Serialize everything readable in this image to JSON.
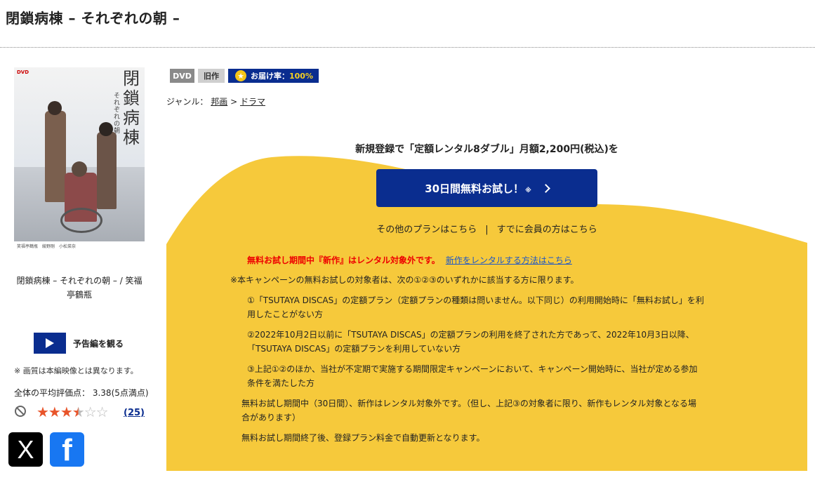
{
  "page": {
    "title": "閉鎖病棟 – それぞれの朝 –"
  },
  "jacket": {
    "dvd_mark": "DVD",
    "vertical_title": "閉鎖病棟",
    "vertical_subtitle": "それぞれの朝",
    "cast_line": "笑福亭鶴瓶　綾野剛　小松菜奈",
    "caption": "閉鎖病棟 – それぞれの朝 – / 笑福亭鶴瓶"
  },
  "trailer": {
    "label": "予告編を観る",
    "icon": "play-icon"
  },
  "quality_note": "※ 画質は本編映像とは異なります。",
  "rating": {
    "label": "全体の平均評価点：",
    "value": "3.38(5点満点)",
    "stars_filled": "★★★",
    "stars_half": "★",
    "stars_empty": "☆☆",
    "score": 3.38,
    "review_count": "(25)",
    "not_interested_icon": "prohibited-icon"
  },
  "share": {
    "x_glyph": "X",
    "facebook_glyph": "f"
  },
  "badges": {
    "format": "DVD",
    "age": "旧作",
    "delivery_label": "お届け率：",
    "delivery_rate": "100%"
  },
  "genre": {
    "label": "ジャンル：",
    "path": [
      "邦画",
      "ドラマ"
    ],
    "separator": ">"
  },
  "campaign": {
    "headline": "新規登録で「定額レンタル8ダブル」月額2,200円(税込)を",
    "trial_button": "30日間無料お試し！",
    "trial_mark": "※",
    "other_plans": "その他のプランはこちら",
    "link_separator": "|",
    "members": "すでに会員の方はこちら",
    "warning": "無料お試し期間中『新作』はレンタル対象外です。",
    "warning_link": "新作をレンタルする方法はこちら",
    "notes": {
      "intro": "※本キャンペーンの無料お試しの対象者は、次の①②③のいずれかに該当する方に限ります。",
      "n1_a": "①「TSUTAYA DISCAS」の定額プラン（定額プランの種類は問いません。以下同じ）の利用開始時に「無料お試し」を利",
      "n1_b": "用したことがない方",
      "n2_a": "②2022年10月2日以前に「TSUTAYA DISCAS」の定額プランの利用を終了された方であって、2022年10月3日以降、",
      "n2_b": "「TSUTAYA DISCAS」の定額プランを利用していない方",
      "n3_a": "③上記①②のほか、当社が不定期で実施する期間限定キャンペーンにおいて、キャンペーン開始時に、当社が定める参加",
      "n3_b": "条件を満たした方",
      "p1_a": "無料お試し期間中（30日間）、新作はレンタル対象外です。（但し、上記③の対象者に限り、新作もレンタル対象となる場",
      "p1_b": "合があります）",
      "p2": "無料お試し期間終了後、登録プラン料金で自動更新となります。"
    }
  },
  "colors": {
    "accent_blue": "#0a2d8f",
    "campaign_yellow": "#f6c93b",
    "warning_red": "#e00000",
    "link_blue": "#1b56c9",
    "star_orange": "#e8542a"
  }
}
